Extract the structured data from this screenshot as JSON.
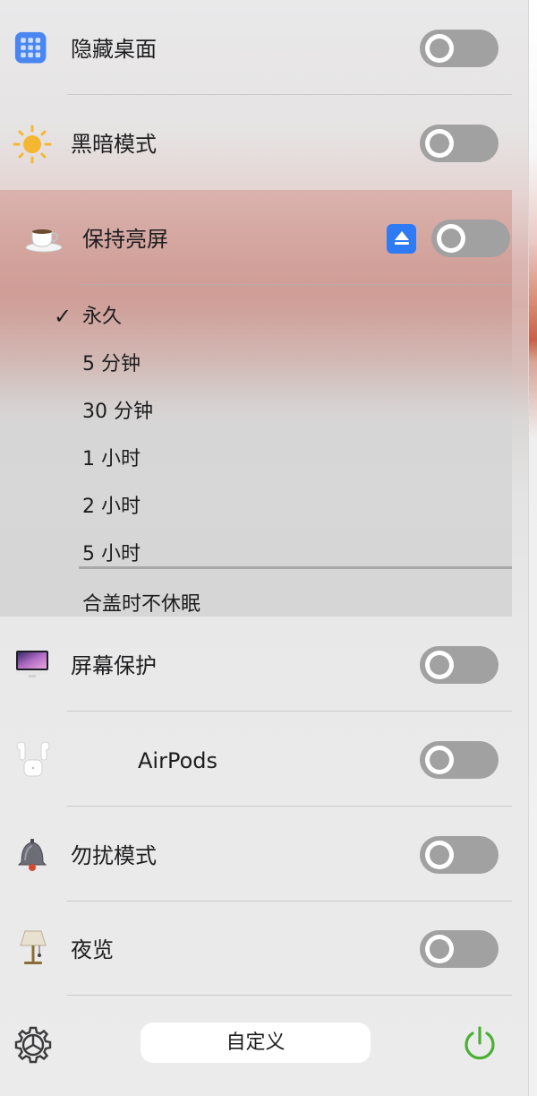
{
  "menu": {
    "items": [
      {
        "id": "hide-desktop",
        "label": "隐藏桌面"
      },
      {
        "id": "dark-mode",
        "label": "黑暗模式"
      },
      {
        "id": "screen-saver",
        "label": "屏幕保护"
      },
      {
        "id": "airpods",
        "label": "AirPods"
      },
      {
        "id": "do-not-disturb",
        "label": "勿扰模式"
      },
      {
        "id": "night-shift",
        "label": "夜览"
      }
    ],
    "keep_awake": {
      "label": "保持亮屏",
      "options": [
        "永久",
        "5 分钟",
        "30 分钟",
        "1 小时",
        "2 小时",
        "5 小时"
      ],
      "selected_check": "✓",
      "lid_option": "合盖时不休眠"
    },
    "customize_label": "自定义"
  },
  "colors": {
    "toggle_off": "#a1a1a1",
    "accent_blue": "#2f7bf6",
    "power_green": "#4caf35"
  }
}
